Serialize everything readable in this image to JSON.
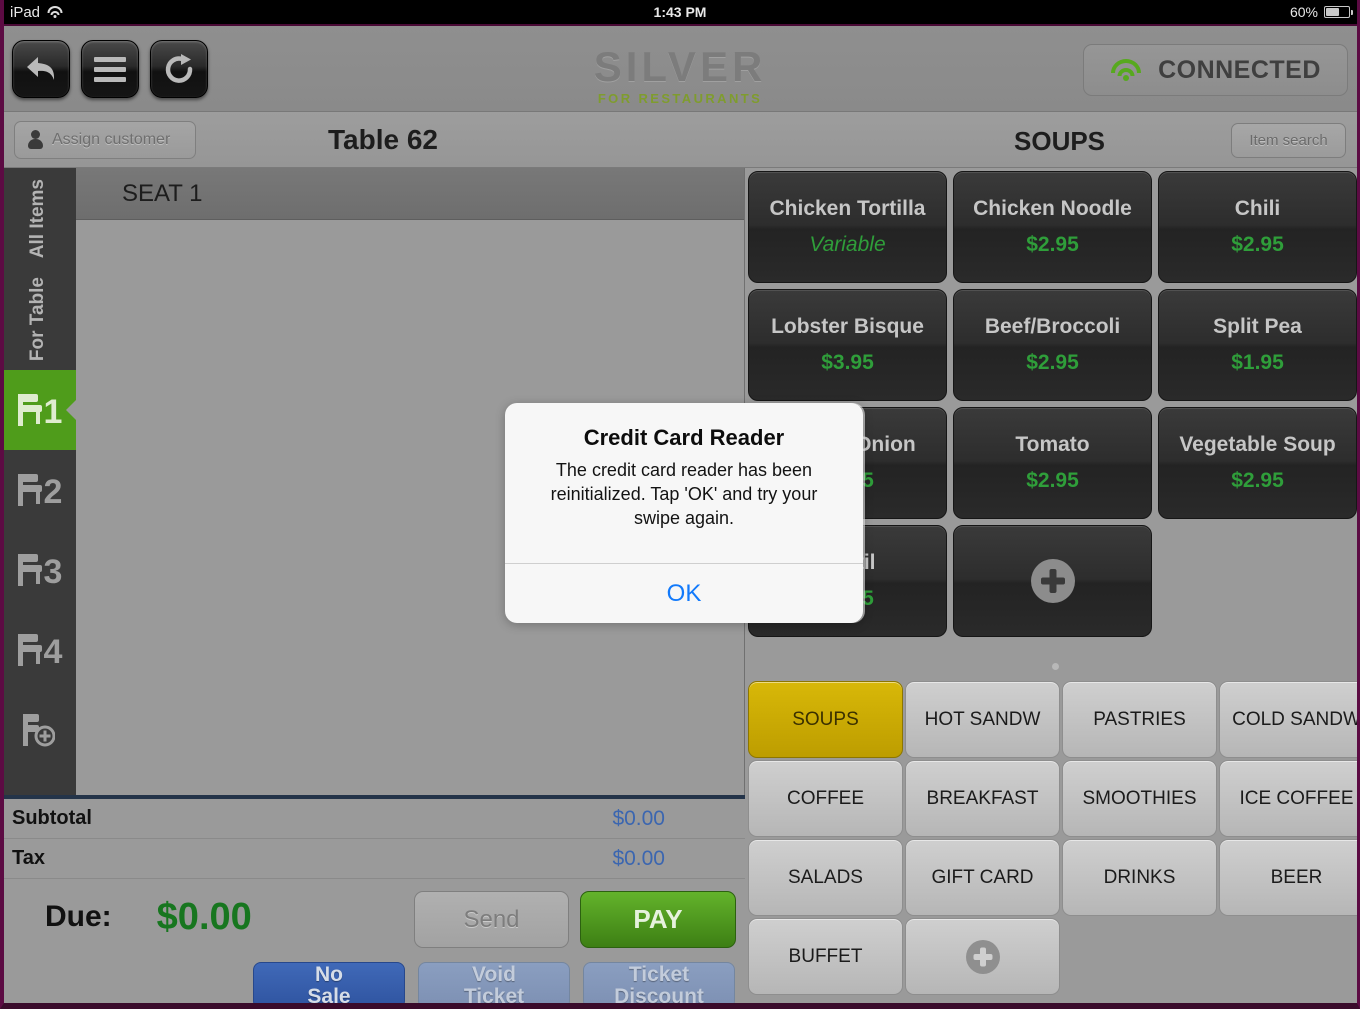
{
  "statusbar": {
    "device": "iPad",
    "wifi_icon": "wifi-icon",
    "time": "1:43 PM",
    "battery_percent": "60%",
    "battery_icon": "battery-icon"
  },
  "topbar": {
    "back_icon": "back-arrow-icon",
    "menu_icon": "hamburger-menu-icon",
    "switch_icon": "switch-user-icon",
    "logo_main": "SILVER",
    "logo_sub": "FOR RESTAURANTS",
    "connection_label": "CONNECTED",
    "connection_icon": "wifi-icon",
    "connection_color": "#57a91e"
  },
  "subbar": {
    "assign_customer_label": "Assign customer",
    "assign_customer_icon": "person-icon",
    "table_title": "Table 62",
    "category_title": "SOUPS",
    "item_search_label": "Item search"
  },
  "seat_rail": {
    "all_items_label": "All Items",
    "for_table_label": "For Table",
    "seats": [
      {
        "number": "1",
        "active": true
      },
      {
        "number": "2",
        "active": false
      },
      {
        "number": "3",
        "active": false
      },
      {
        "number": "4",
        "active": false
      }
    ],
    "add_seat_icon": "add-seat-icon",
    "active_color": "#4f9c1b"
  },
  "order": {
    "seat_header": "SEAT 1",
    "items": []
  },
  "totals": {
    "subtotal_label": "Subtotal",
    "subtotal_value": "$0.00",
    "tax_label": "Tax",
    "tax_value": "$0.00",
    "due_label": "Due:",
    "due_value": "$0.00",
    "due_color": "#17761f",
    "send_label": "Send",
    "pay_label": "PAY",
    "pay_color": "#4d9a1c",
    "actions": [
      {
        "line1": "No",
        "line2": "Sale",
        "style": "primary"
      },
      {
        "line1": "Void",
        "line2": "Ticket",
        "style": "muted"
      },
      {
        "line1": "Ticket",
        "line2": "Discount",
        "style": "muted"
      }
    ]
  },
  "items": [
    {
      "name": "Chicken Tortilla",
      "price": "Variable",
      "variable": true
    },
    {
      "name": "Chicken Noodle",
      "price": "$2.95",
      "variable": false
    },
    {
      "name": "Chili",
      "price": "$2.95",
      "variable": false
    },
    {
      "name": "Lobster Bisque",
      "price": "$3.95",
      "variable": false
    },
    {
      "name": "Beef/Broccoli",
      "price": "$2.95",
      "variable": false
    },
    {
      "name": "Split Pea",
      "price": "$1.95",
      "variable": false
    },
    {
      "name": "French Onion",
      "price": "$2.95",
      "variable": false
    },
    {
      "name": "Tomato",
      "price": "$2.95",
      "variable": false
    },
    {
      "name": "Vegetable Soup",
      "price": "$2.95",
      "variable": false
    },
    {
      "name": "Lentil",
      "price": "$2.95",
      "variable": false
    }
  ],
  "add_item_icon": "plus-icon",
  "categories": [
    {
      "label": "SOUPS",
      "active": true
    },
    {
      "label": "HOT SANDW",
      "active": false
    },
    {
      "label": "PASTRIES",
      "active": false
    },
    {
      "label": "COLD SANDW",
      "active": false
    },
    {
      "label": "COFFEE",
      "active": false
    },
    {
      "label": "BREAKFAST",
      "active": false
    },
    {
      "label": "SMOOTHIES",
      "active": false
    },
    {
      "label": "ICE COFFEE",
      "active": false
    },
    {
      "label": "SALADS",
      "active": false
    },
    {
      "label": "GIFT CARD",
      "active": false
    },
    {
      "label": "DRINKS",
      "active": false
    },
    {
      "label": "BEER",
      "active": false
    },
    {
      "label": "BUFFET",
      "active": false
    }
  ],
  "add_category_icon": "plus-icon",
  "active_category_color": "#c9a907",
  "modal": {
    "title": "Credit Card Reader",
    "text": "The credit card reader has been reinitialized.  Tap 'OK' and try your swipe again.",
    "ok_label": "OK",
    "ok_color": "#127afb"
  }
}
